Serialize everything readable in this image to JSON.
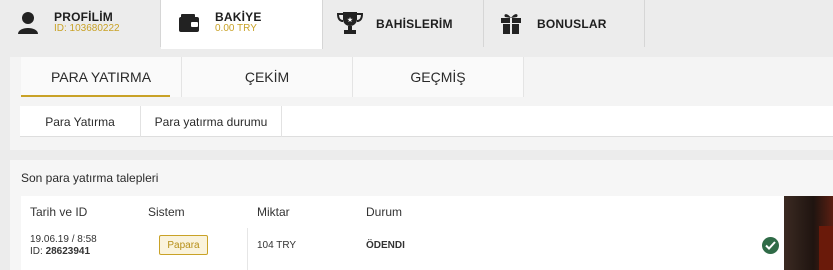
{
  "top_tabs": [
    {
      "title": "PROFİLİM",
      "subtitle": "ID: 103680222",
      "icon": "user-icon"
    },
    {
      "title": "BAKİYE",
      "subtitle": "0.00 TRY",
      "icon": "wallet-icon"
    },
    {
      "title": "BAHİSLERİM",
      "icon": "trophy-icon"
    },
    {
      "title": "BONUSLAR",
      "icon": "gift-icon"
    }
  ],
  "sub_tabs": [
    "PARA YATIRMA",
    "ÇEKİM",
    "GEÇMİŞ"
  ],
  "sub_sub_tabs": [
    "Para Yatırma",
    "Para yatırma durumu"
  ],
  "section_title": "Son para yatırma talepleri",
  "table": {
    "headers": [
      "Tarih ve ID",
      "Sistem",
      "Miktar",
      "Durum"
    ],
    "rows": [
      {
        "date": "19.06.19 / 8:58",
        "id_label": "ID:",
        "id": "28623941",
        "system": "Papara",
        "amount": "104 TRY",
        "status": "ÖDENDI"
      }
    ]
  },
  "colors": {
    "accent": "#c9a227",
    "success": "#2f6b47"
  }
}
